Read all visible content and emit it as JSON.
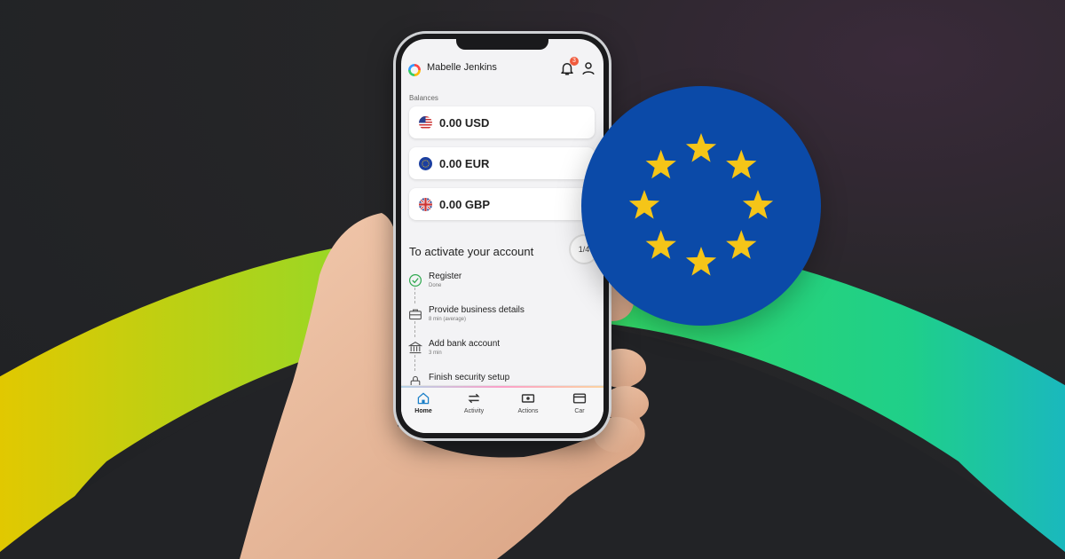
{
  "user": {
    "name": "Mabelle Jenkins",
    "notification_count": "3"
  },
  "balances": {
    "label": "Balances",
    "items": [
      {
        "currency": "USD",
        "amount": "0.00 USD",
        "flag_icon": "us-flag-icon"
      },
      {
        "currency": "EUR",
        "amount": "0.00 EUR",
        "flag_icon": "eu-flag-icon"
      },
      {
        "currency": "GBP",
        "amount": "0.00 GBP",
        "flag_icon": "uk-flag-icon"
      }
    ]
  },
  "activation": {
    "title": "To activate your account",
    "progress": "1/4",
    "steps": [
      {
        "title": "Register",
        "subtitle": "Done",
        "icon": "check-circle-icon"
      },
      {
        "title": "Provide business details",
        "subtitle": "8 min (average)",
        "icon": "briefcase-icon"
      },
      {
        "title": "Add bank account",
        "subtitle": "3 min",
        "icon": "bank-icon"
      },
      {
        "title": "Finish security setup",
        "subtitle": "",
        "icon": "lock-icon"
      }
    ]
  },
  "tabs": [
    {
      "label": "Home",
      "icon": "home-icon",
      "active": true
    },
    {
      "label": "Activity",
      "icon": "arrows-icon",
      "active": false
    },
    {
      "label": "Actions",
      "icon": "cash-icon",
      "active": false
    },
    {
      "label": "Car",
      "icon": "card-icon",
      "active": false
    }
  ],
  "colors": {
    "eu_blue": "#0b4aa8",
    "eu_star": "#f5c518",
    "badge": "#f05a3c",
    "arc_yellow": "#e8d000",
    "arc_green": "#22d07a",
    "arc_teal": "#1fb8b0"
  }
}
